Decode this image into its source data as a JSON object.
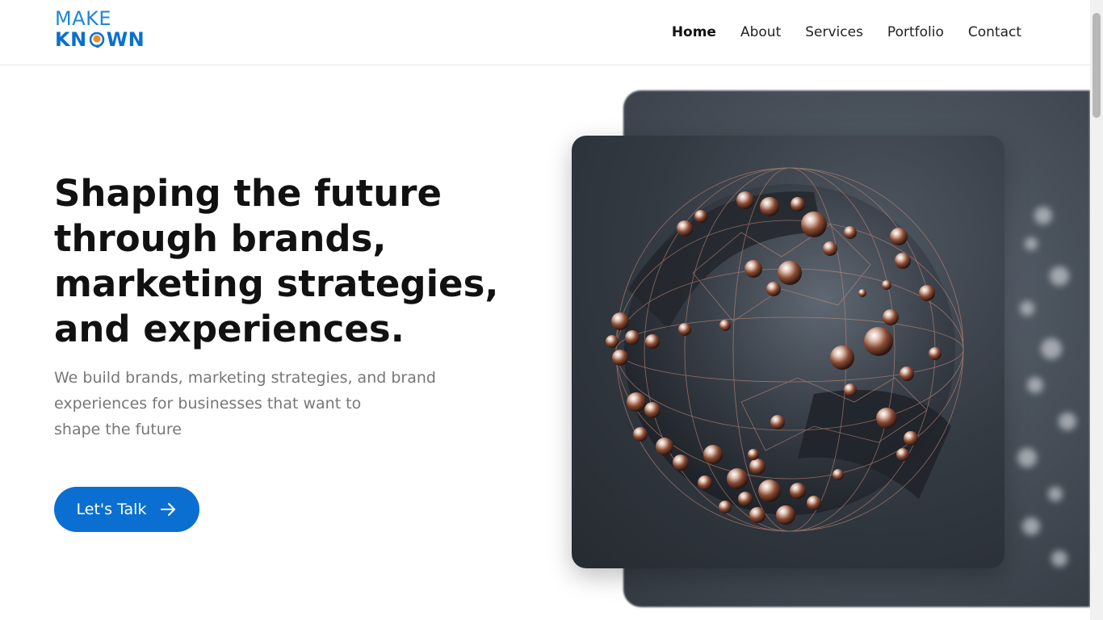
{
  "brand": {
    "line1": "MAKE",
    "line2_part1": "KN",
    "line2_part2": "WN",
    "primary_color": "#0a6fd1",
    "accent_color": "#f08a24"
  },
  "nav": {
    "items": [
      {
        "label": "Home",
        "active": true
      },
      {
        "label": "About",
        "active": false
      },
      {
        "label": "Services",
        "active": false
      },
      {
        "label": "Portfolio",
        "active": false
      },
      {
        "label": "Contact",
        "active": false
      }
    ]
  },
  "hero": {
    "headline_lines": [
      "Shaping the future",
      "through brands,",
      "marketing strategies,",
      "and experiences."
    ],
    "subtext_lines": [
      "We build brands, marketing strategies, and brand",
      "experiences for businesses that want to",
      "shape the future"
    ],
    "cta_label": "Let's Talk",
    "cta_icon": "arrow-right-icon"
  },
  "imagery": {
    "main_image": "abstract-3d-sphere-with-copper-balls",
    "background_image": "blurred-abstract-sphere"
  }
}
